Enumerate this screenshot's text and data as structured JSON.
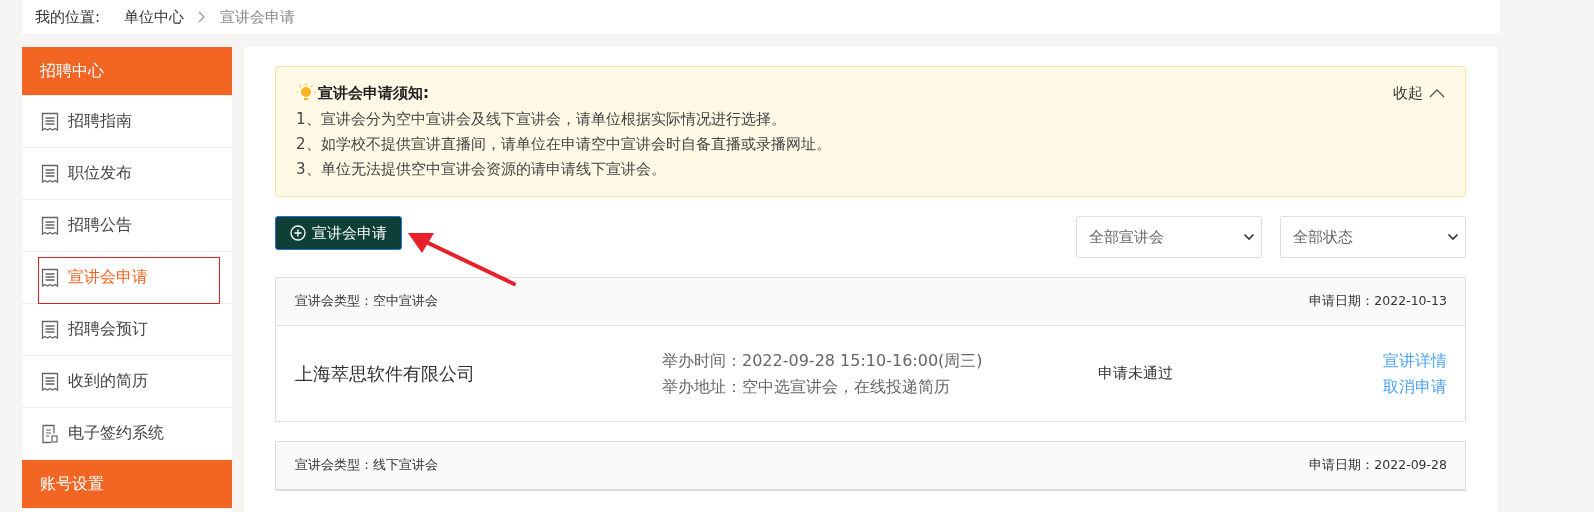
{
  "breadcrumb": {
    "label": "我的位置:",
    "items": [
      {
        "text": "单位中心",
        "current": false
      },
      {
        "text": "宣讲会申请",
        "current": true
      }
    ]
  },
  "sidebar": {
    "sections": [
      {
        "title": "招聘中心",
        "items": [
          {
            "label": "招聘指南",
            "selected": false,
            "kind": "list"
          },
          {
            "label": "职位发布",
            "selected": false,
            "kind": "list"
          },
          {
            "label": "招聘公告",
            "selected": false,
            "kind": "list"
          },
          {
            "label": "宣讲会申请",
            "selected": true,
            "kind": "list"
          },
          {
            "label": "招聘会预订",
            "selected": false,
            "kind": "list"
          },
          {
            "label": "收到的简历",
            "selected": false,
            "kind": "list"
          },
          {
            "label": "电子签约系统",
            "selected": false,
            "kind": "sign"
          }
        ]
      },
      {
        "title": "账号设置"
      }
    ]
  },
  "notice": {
    "title": "宣讲会申请须知:",
    "collapse": "收起",
    "expanded": true,
    "lines": [
      "1、宣讲会分为空中宣讲会及线下宣讲会，请单位根据实际情况进行选择。",
      "2、如学校不提供宣讲直播间，请单位在申请空中宣讲会时自备直播或录播网址。",
      "3、单位无法提供空中宣讲会资源的请申请线下宣讲会。"
    ]
  },
  "apply_button": "宣讲会申请",
  "filters": [
    {
      "value": "全部宣讲会"
    },
    {
      "value": "全部状态"
    }
  ],
  "records": [
    {
      "type": "宣讲会类型：空中宣讲会",
      "date": "申请日期：2022-10-13",
      "company": "上海萃思软件有限公司",
      "time": "举办时间：2022-09-28 15:10-16:00(周三)",
      "address": "举办地址：空中选宣讲会，在线投递简历",
      "status": "申请未通过",
      "actions": [
        "宣讲详情",
        "取消申请"
      ]
    },
    {
      "type": "宣讲会类型：线下宣讲会",
      "date": "申请日期：2022-09-28"
    }
  ]
}
